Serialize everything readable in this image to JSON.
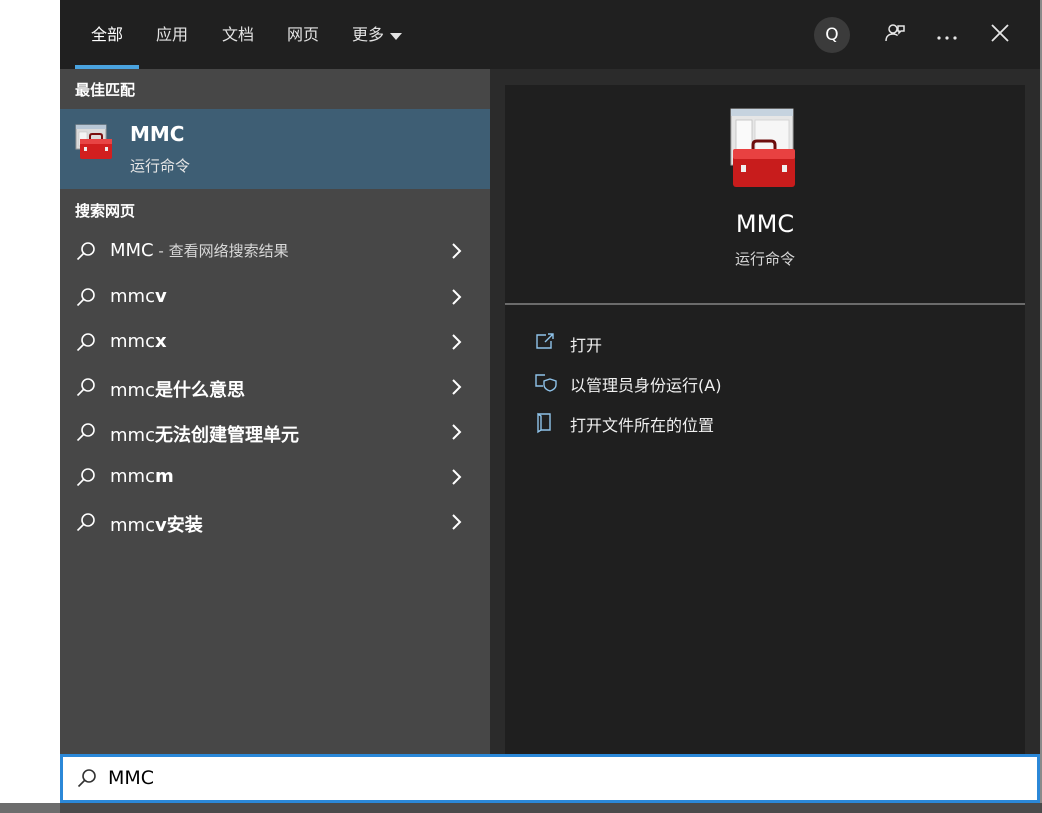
{
  "tabs": [
    {
      "label": "全部",
      "active": true
    },
    {
      "label": "应用",
      "active": false
    },
    {
      "label": "文档",
      "active": false
    },
    {
      "label": "网页",
      "active": false
    },
    {
      "label": "更多",
      "active": false
    }
  ],
  "topbar": {
    "account_badge": "Q",
    "icons": [
      "account-icon",
      "feedback-icon",
      "more-options-icon",
      "close-icon"
    ]
  },
  "best_match": {
    "section_title": "最佳匹配",
    "title": "MMC",
    "subtitle": "运行命令",
    "icon": "toolbox-app-icon"
  },
  "web_search": {
    "section_title": "搜索网页",
    "items": [
      {
        "prefix": "MMC",
        "bold": "",
        "suffix": " - 查看网络搜索结果"
      },
      {
        "prefix": "mmc",
        "bold": "v",
        "suffix": ""
      },
      {
        "prefix": "mmc",
        "bold": "x",
        "suffix": ""
      },
      {
        "prefix": "mmc",
        "bold": "是什么意思",
        "suffix": ""
      },
      {
        "prefix": "mmc",
        "bold": "无法创建管理单元",
        "suffix": ""
      },
      {
        "prefix": "mmc",
        "bold": "m",
        "suffix": ""
      },
      {
        "prefix": "mmc",
        "bold": "v安装",
        "suffix": ""
      }
    ]
  },
  "detail": {
    "title": "MMC",
    "subtitle": "运行命令",
    "actions": [
      {
        "label": "打开",
        "icon": "open-icon"
      },
      {
        "label": "以管理员身份运行(A)",
        "icon": "admin-shield-icon"
      },
      {
        "label": "打开文件所在的位置",
        "icon": "file-location-icon"
      }
    ]
  },
  "search": {
    "value": "MMC",
    "placeholder": ""
  },
  "colors": {
    "accent": "#4aa3df",
    "selected_bg": "#3e5e74",
    "search_border": "#2b88d8"
  }
}
